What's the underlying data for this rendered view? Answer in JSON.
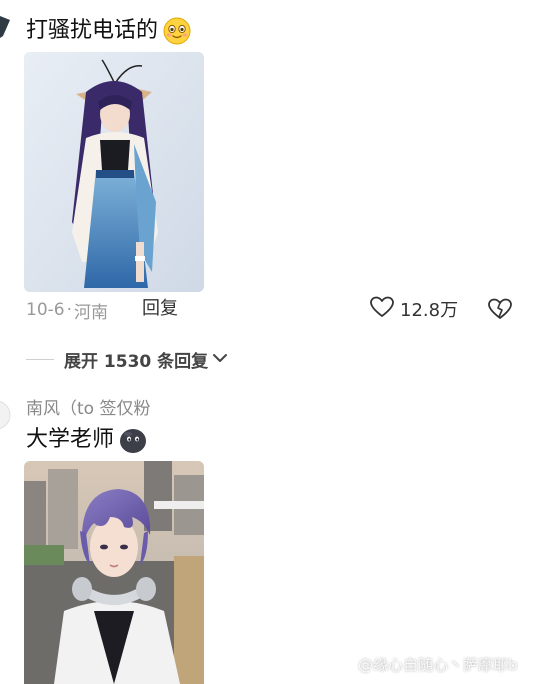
{
  "comment1": {
    "text": "打骚扰电话的",
    "emoji": "blushing-smile-emoji",
    "date": "10-6",
    "separator": "·",
    "location": "河南",
    "reply_label": "回复",
    "likes": "12.8万"
  },
  "expand": {
    "label": "展开 1530 条回复"
  },
  "comment2": {
    "author": "南风（to 签仅粉",
    "text": "大学老师",
    "emoji": "dark-blob-emoji"
  },
  "watermark": {
    "text": "@缘心自随心丶萨摩耶b"
  },
  "icons": {
    "like": "heart-outline-icon",
    "dislike": "broken-heart-icon",
    "expand": "chevron-down-icon"
  }
}
